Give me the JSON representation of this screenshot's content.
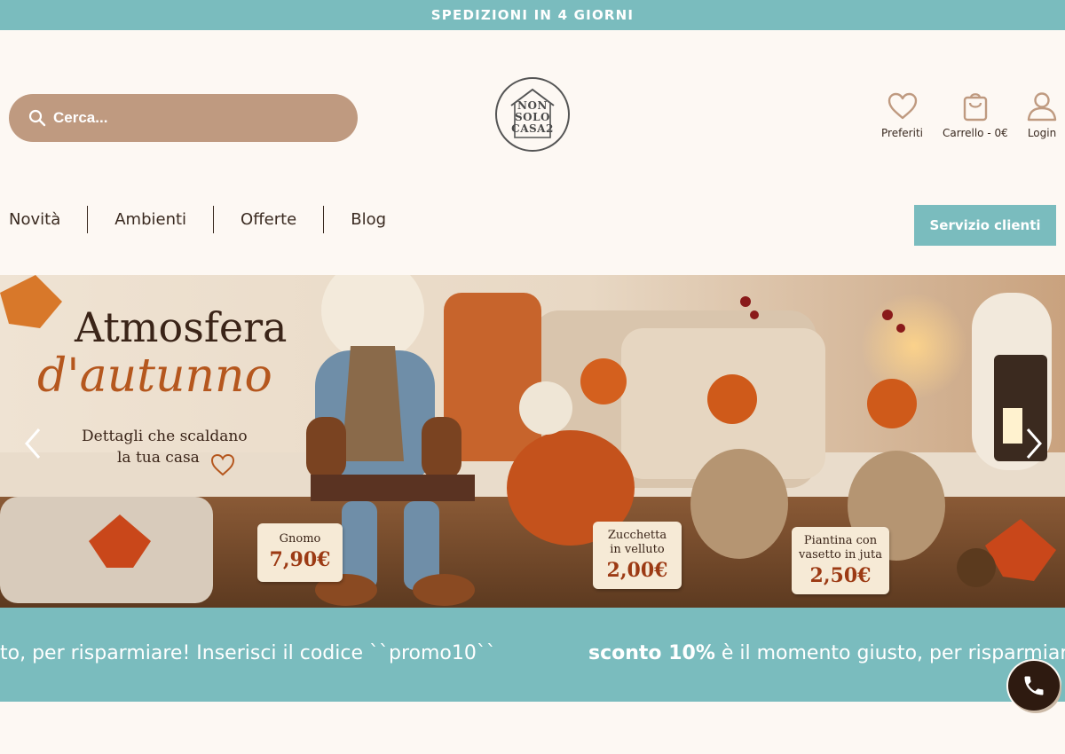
{
  "topbar": {
    "text": "SPEDIZIONI IN 4 GIORNI"
  },
  "search": {
    "placeholder": "Cerca...",
    "icon": "search-icon"
  },
  "logo": {
    "line1": "NON",
    "line2": "SOLO",
    "line3": "CASA2"
  },
  "header_actions": [
    {
      "label": "Preferiti",
      "icon": "heart-icon"
    },
    {
      "label": "Carrello - 0€",
      "icon": "shopping-bag-icon"
    },
    {
      "label": "Login",
      "icon": "user-icon"
    }
  ],
  "nav": {
    "items": [
      "Novità",
      "Ambienti",
      "Offerte",
      "Blog"
    ]
  },
  "service_button": {
    "label": "Servizio clienti"
  },
  "hero": {
    "title": "Atmosfera",
    "script": "d'autunno",
    "subtitle_line1": "Dettagli che scaldano",
    "subtitle_line2": "la tua casa",
    "products": [
      {
        "name_line1": "Gnomo",
        "name_line2": "",
        "price": "7,90€"
      },
      {
        "name_line1": "Zucchetta",
        "name_line2": "in velluto",
        "price": "2,00€"
      },
      {
        "name_line1": "Piantina con",
        "name_line2": "vasetto in juta",
        "price": "2,50€"
      }
    ]
  },
  "promo": {
    "left_text": "to, per risparmiare! Inserisci il codice ``promo10``",
    "right_bold": "sconto 10%",
    "right_text": " è il momento giusto, per risparmiar"
  },
  "colors": {
    "teal": "#7abcbe",
    "search_bg": "#bf9a80",
    "page_bg": "#fdf8f3",
    "brown_text": "#3a2a20",
    "icon": "#bf9a80"
  }
}
